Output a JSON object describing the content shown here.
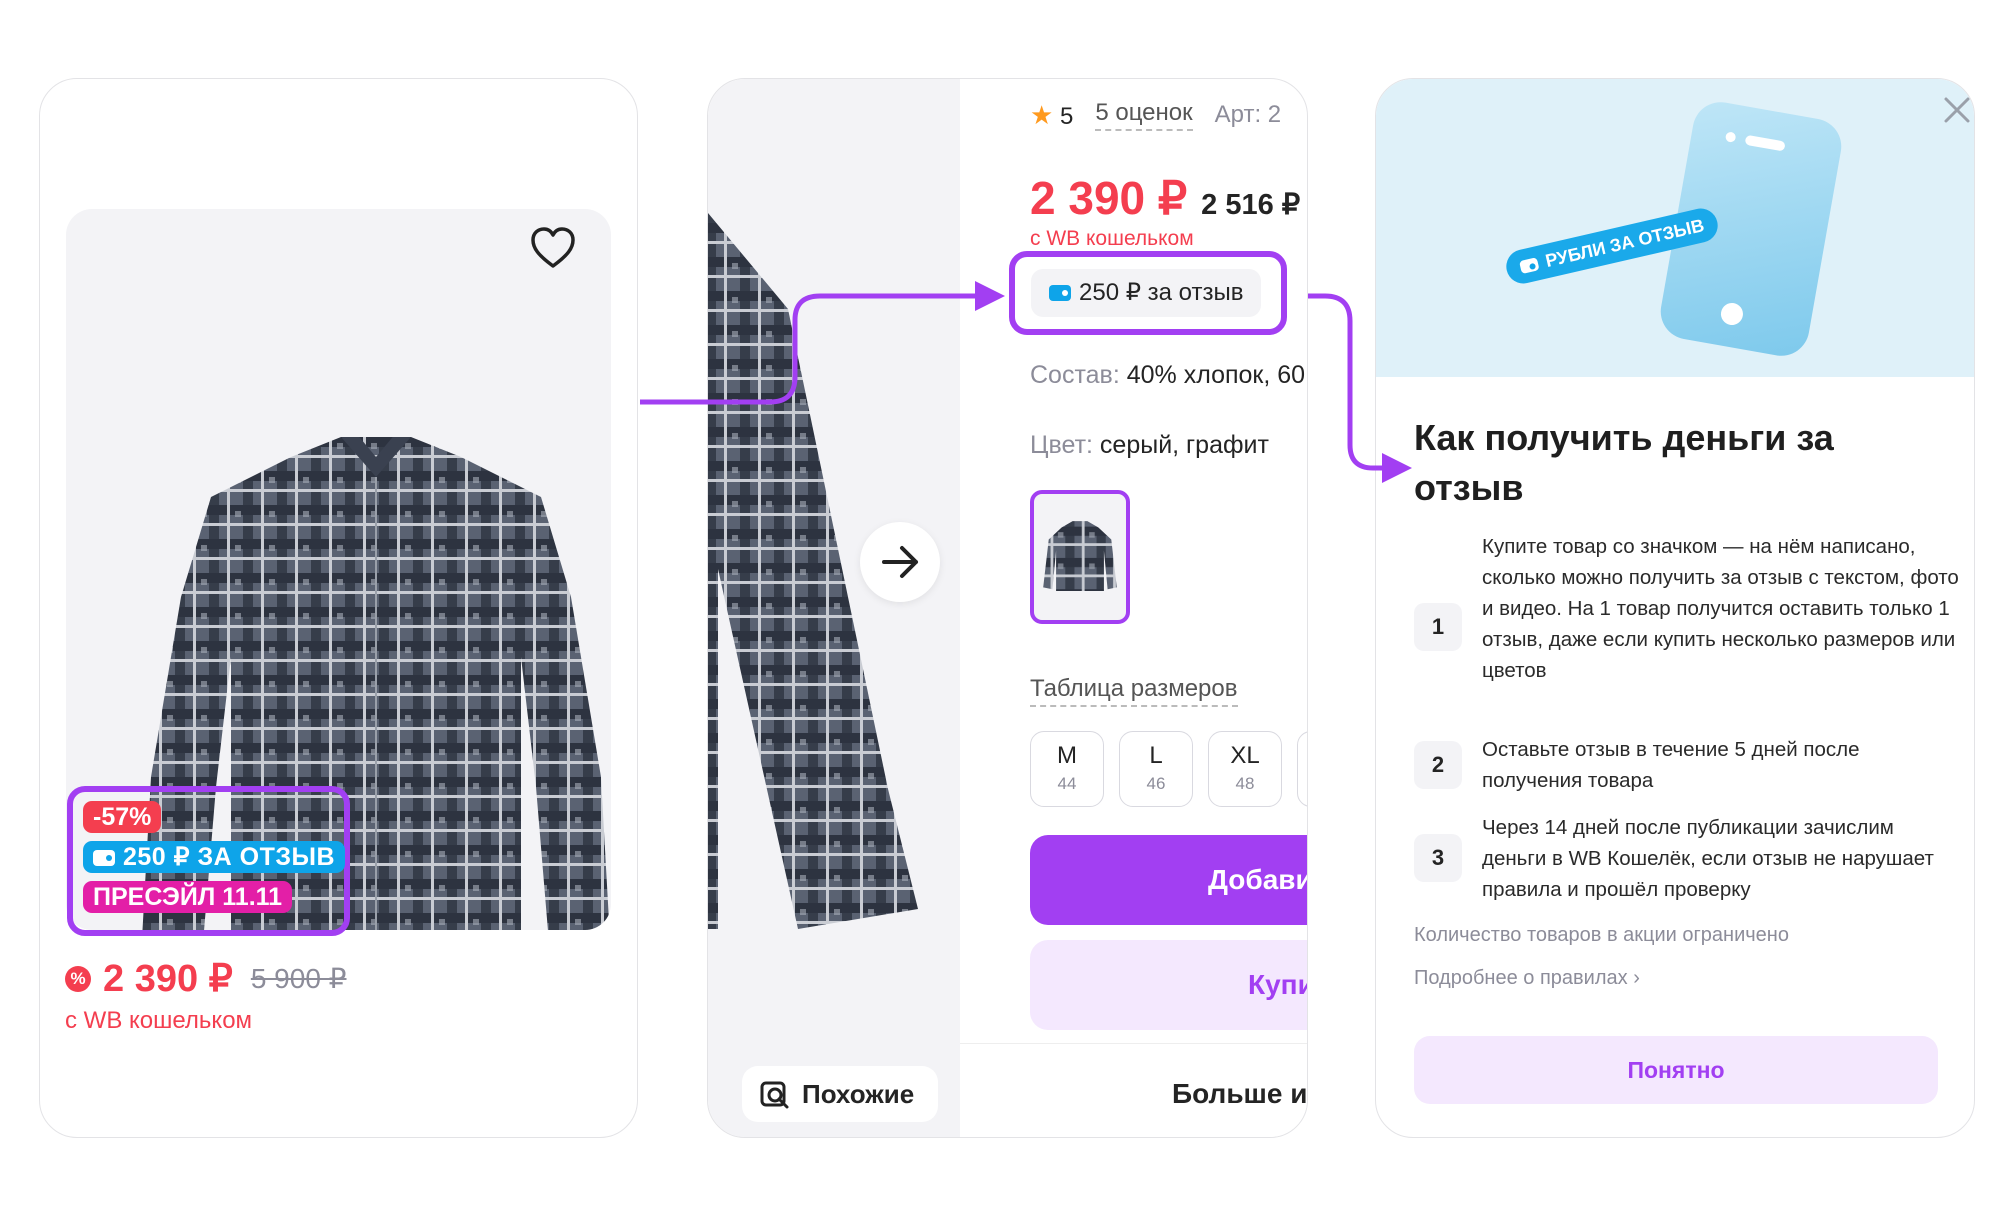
{
  "card": {
    "discount_badge": "-57%",
    "review_badge": "250 ₽ ЗА ОТЗЫВ",
    "presale_badge": "ПРЕСЭЙЛ 11.11",
    "price": "2 390 ₽",
    "old_price": "5 900 ₽",
    "wallet_note": "с WB кошельком"
  },
  "product": {
    "rating": "5",
    "reviews_count": "5 оценок",
    "article": "Арт: 2",
    "price": "2 390 ₽",
    "price_without_wallet": "2 516 ₽",
    "wallet_note": "с WB кошельком",
    "review_reward": "250 ₽ за отзыв",
    "composition_label": "Состав:",
    "composition_value": "40% хлопок, 60",
    "color_label": "Цвет:",
    "color_value": "серый, графит",
    "size_table_label": "Таблица размеров",
    "sizes": [
      {
        "size": "M",
        "ru": "44"
      },
      {
        "size": "L",
        "ru": "46"
      },
      {
        "size": "XL",
        "ru": "48"
      }
    ],
    "add_button": "Добави",
    "buy_button": "Купи",
    "similar_button": "Похожие",
    "more_label": "Больше и"
  },
  "modal": {
    "ribbon": "РУБЛИ ЗА ОТЗЫВ",
    "title": "Как получить деньги за отзыв",
    "steps": [
      {
        "num": "1",
        "text": "Купите товар со значком — на нём написано, сколько можно получить за отзыв с текстом, фото и видео. На 1 товар получится оставить только 1 отзыв, даже если купить несколько размеров или цветов"
      },
      {
        "num": "2",
        "text": "Оставьте отзыв в течение 5 дней после получения товара"
      },
      {
        "num": "3",
        "text": "Через 14 дней после публикации зачислим деньги в WB Кошелёк, если отзыв не нарушает правила и прошёл проверку"
      }
    ],
    "limit_note": "Количество товаров в акции ограничено",
    "rules_link": "Подробнее о правилах",
    "ok_button": "Понятно"
  },
  "colors": {
    "accent": "#a23ff2",
    "price_red": "#f43e4f",
    "review_blue": "#0ea4e9",
    "presale_pink": "#e31fa7"
  }
}
